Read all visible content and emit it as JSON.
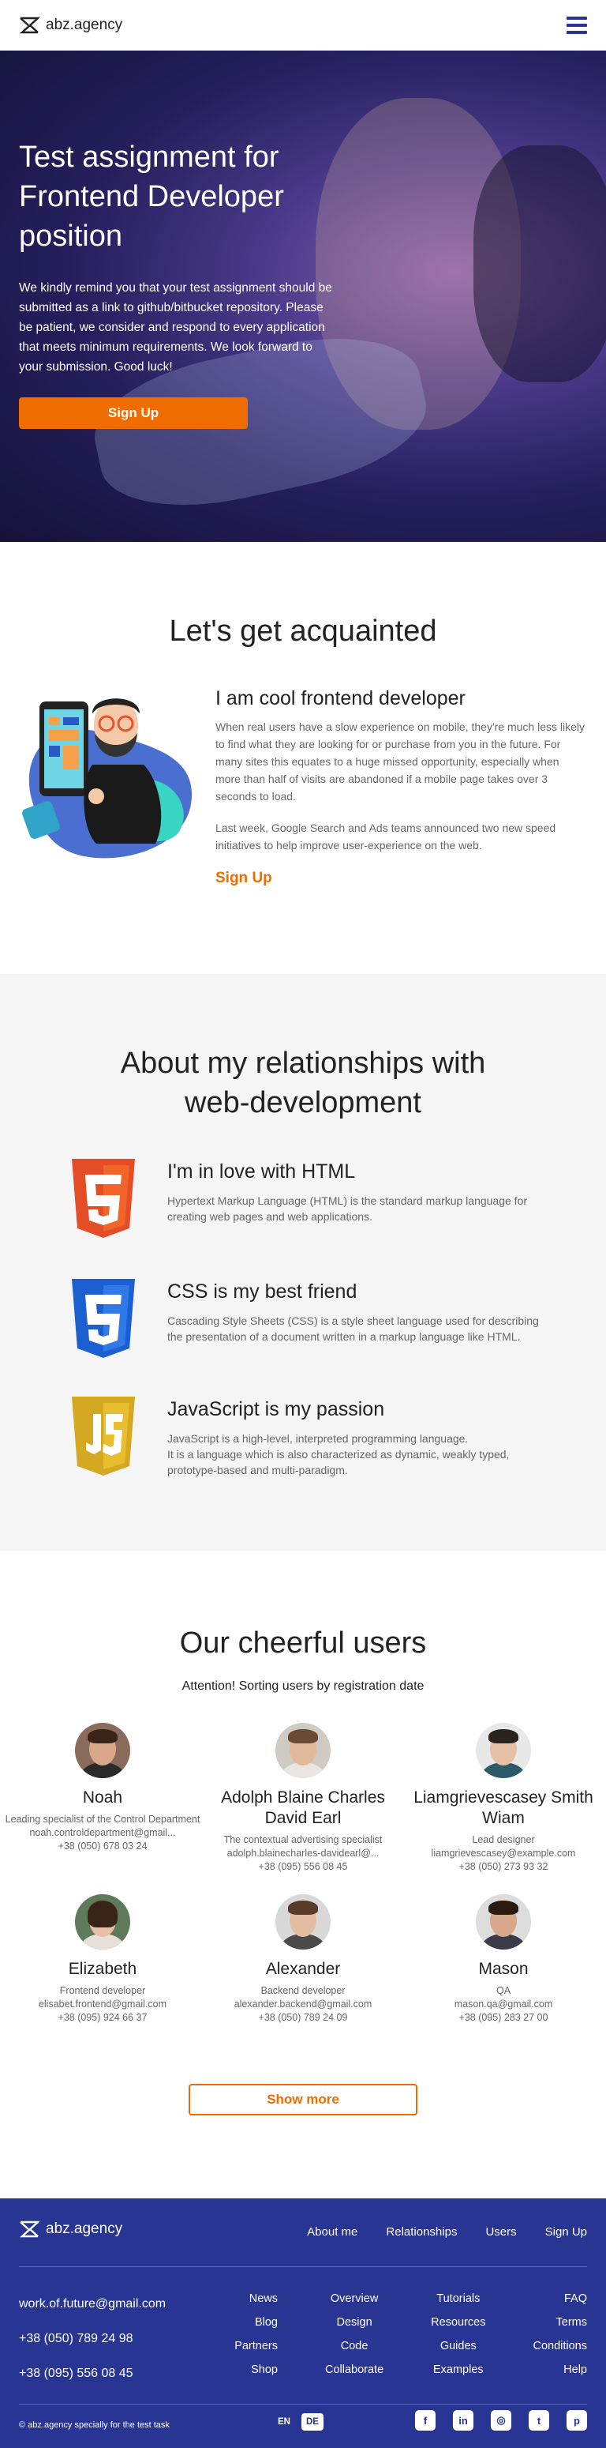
{
  "header": {
    "logo_text": "abz.agency",
    "menu_icon": "hamburger-icon"
  },
  "hero": {
    "title": "Test assignment for Frontend Developer position",
    "text": "We kindly remind you that your test assignment should be submitted as a link to github/bitbucket repository. Please be patient, we consider and respond to every application that meets minimum requirements. We look forward to your submission. Good luck!",
    "button": "Sign Up"
  },
  "acquainted": {
    "title": "Let's get acquainted",
    "heading": "I am cool frontend developer",
    "p1": "When real users have a slow experience on mobile, they're much less likely to find what they are looking for or purchase from you in the future. For many sites this equates to a huge missed opportunity, especially when more than half of visits are abandoned if a mobile page takes over 3 seconds to load.",
    "p2": "Last week, Google Search and Ads teams announced two new speed initiatives to help improve user-experience on the web.",
    "link": "Sign Up"
  },
  "relationships": {
    "title": "About my relationships with web-development",
    "items": [
      {
        "icon": "html5-icon",
        "heading": "I'm in love with HTML",
        "text": "Hypertext Markup Language (HTML) is the standard markup language for creating web pages and web applications."
      },
      {
        "icon": "css3-icon",
        "heading": "CSS is my best friend",
        "text": "Cascading Style Sheets (CSS) is a style sheet language used for describing the presentation of a document written in a markup language like HTML."
      },
      {
        "icon": "javascript-icon",
        "heading": "JavaScript is my passion",
        "text": "JavaScript is a high-level, interpreted programming language.\nIt is a language which is also characterized as dynamic, weakly typed, prototype-based and multi-paradigm."
      }
    ]
  },
  "users": {
    "title": "Our cheerful users",
    "subtitle": "Attention! Sorting users by registration date",
    "list": [
      {
        "name": "Noah",
        "position": "Leading specialist of the Control Department",
        "email": "noah.controldepartment@gmail...",
        "phone": "+38 (050) 678 03 24"
      },
      {
        "name": "Adolph Blaine Charles David Earl",
        "position": "The contextual advertising specialist",
        "email": "adolph.blainecharles-davidearl@...",
        "phone": "+38 (095) 556 08 45"
      },
      {
        "name": "Liamgrievescasey Smith Wiam",
        "position": "Lead designer",
        "email": "liamgrievescasey@example.com",
        "phone": "+38 (050) 273 93 32"
      },
      {
        "name": "Elizabeth",
        "position": "Frontend developer",
        "email": "elisabet.frontend@gmail.com",
        "phone": "+38 (095) 924 66 37"
      },
      {
        "name": "Alexander",
        "position": "Backend developer",
        "email": "alexander.backend@gmail.com",
        "phone": "+38 (050) 789 24 09"
      },
      {
        "name": "Mason",
        "position": "QA",
        "email": "mason.qa@gmail.com",
        "phone": "+38 (095) 283 27 00"
      }
    ],
    "show_more": "Show more"
  },
  "footer": {
    "logo_text": "abz.agency",
    "nav": [
      "About me",
      "Relationships",
      "Users",
      "Sign Up"
    ],
    "email": "work.of.future@gmail.com",
    "phones": [
      "+38 (050) 789 24 98",
      "+38 (095) 556 08 45"
    ],
    "columns": [
      [
        "News",
        "Blog",
        "Partners",
        "Shop"
      ],
      [
        "Overview",
        "Design",
        "Code",
        "Collaborate"
      ],
      [
        "Tutorials",
        "Resources",
        "Guides",
        "Examples"
      ],
      [
        "FAQ",
        "Terms",
        "Conditions",
        "Help"
      ]
    ],
    "copyright": "© abz.agency specially for the test task",
    "languages": [
      "EN",
      "DE"
    ],
    "social": [
      "facebook-icon",
      "linkedin-icon",
      "instagram-icon",
      "twitter-icon",
      "pinterest-icon"
    ],
    "social_glyphs": [
      "f",
      "in",
      "◎",
      "t",
      "p"
    ]
  },
  "colors": {
    "brand": "#283593",
    "accent": "#ef6c00",
    "light_bg": "#f5f5f5"
  }
}
